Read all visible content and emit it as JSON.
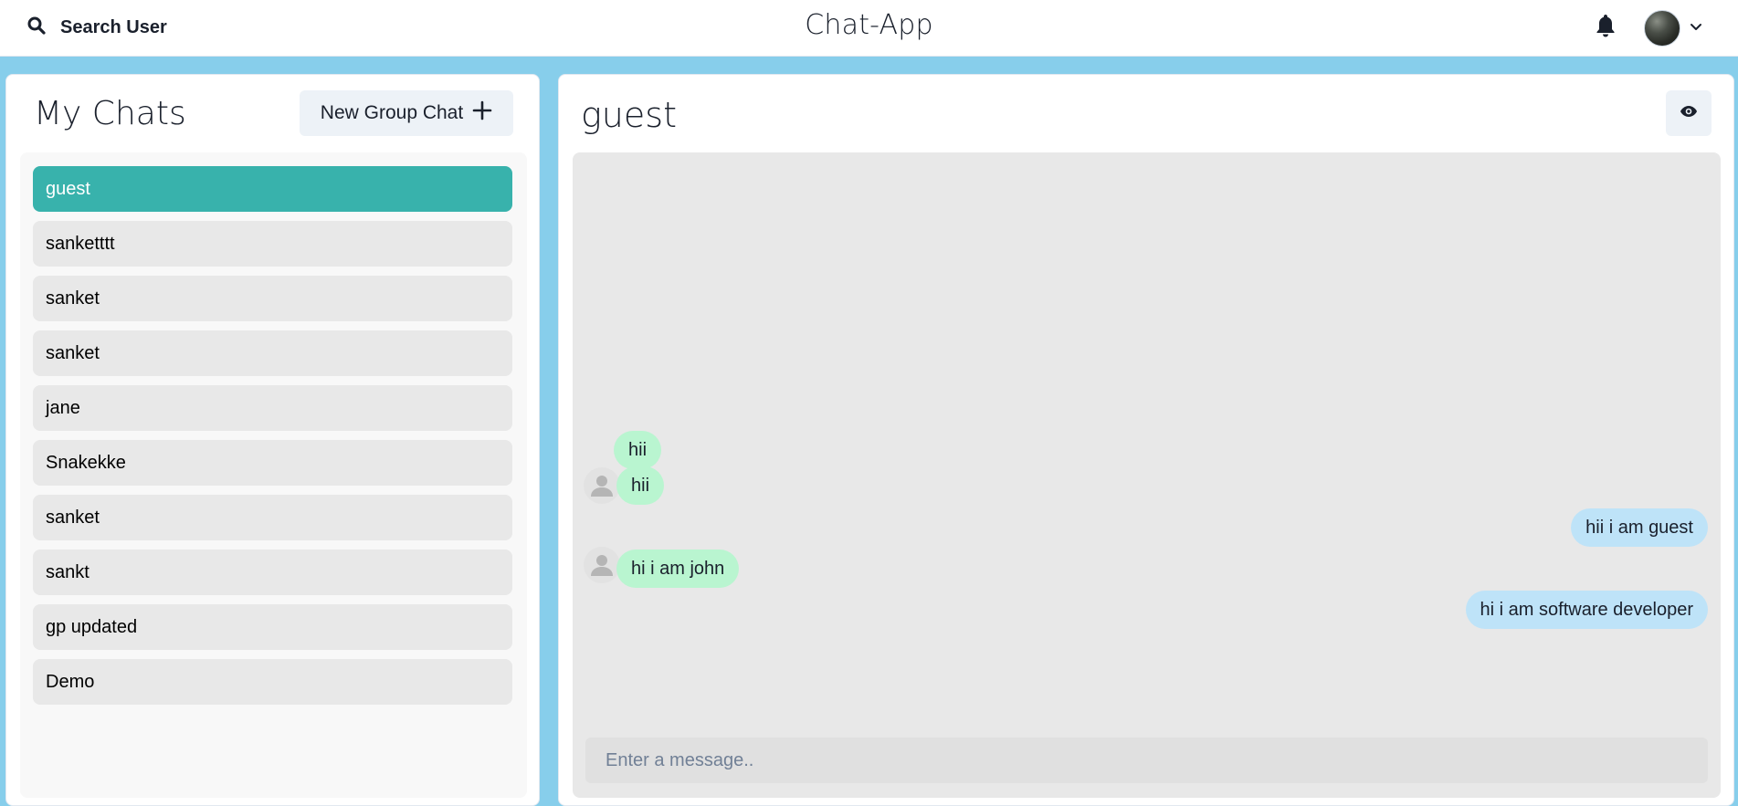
{
  "header": {
    "search_label": "Search User",
    "app_title": "Chat-App",
    "search_icon": "search-icon",
    "notification_icon": "bell-icon",
    "profile_icon": "chevron-down-icon"
  },
  "sidebar": {
    "title": "My Chats",
    "new_group_label": "New Group Chat",
    "chats": [
      {
        "name": "guest",
        "active": true
      },
      {
        "name": "sanketttt",
        "active": false
      },
      {
        "name": "sanket",
        "active": false
      },
      {
        "name": "sanket",
        "active": false
      },
      {
        "name": "jane",
        "active": false
      },
      {
        "name": "Snakekke",
        "active": false
      },
      {
        "name": "sanket",
        "active": false
      },
      {
        "name": "sankt",
        "active": false
      },
      {
        "name": "gp updated",
        "active": false
      },
      {
        "name": "Demo",
        "active": false
      }
    ]
  },
  "chat": {
    "title": "guest",
    "view_icon": "eye-icon",
    "messages": [
      {
        "text": "hii",
        "direction": "incoming",
        "show_avatar": false
      },
      {
        "text": "hii",
        "direction": "incoming",
        "show_avatar": true
      },
      {
        "text": "hii i am guest",
        "direction": "outgoing",
        "show_avatar": false
      },
      {
        "text": "hi i am john",
        "direction": "incoming",
        "show_avatar": true
      },
      {
        "text": "hi i am software developer",
        "direction": "outgoing",
        "show_avatar": false
      }
    ],
    "input_placeholder": "Enter a message.."
  },
  "colors": {
    "background": "#87ceeb",
    "active_chat": "#38b2ac",
    "incoming_bubble": "#b9f5d0",
    "outgoing_bubble": "#bee3f8"
  }
}
